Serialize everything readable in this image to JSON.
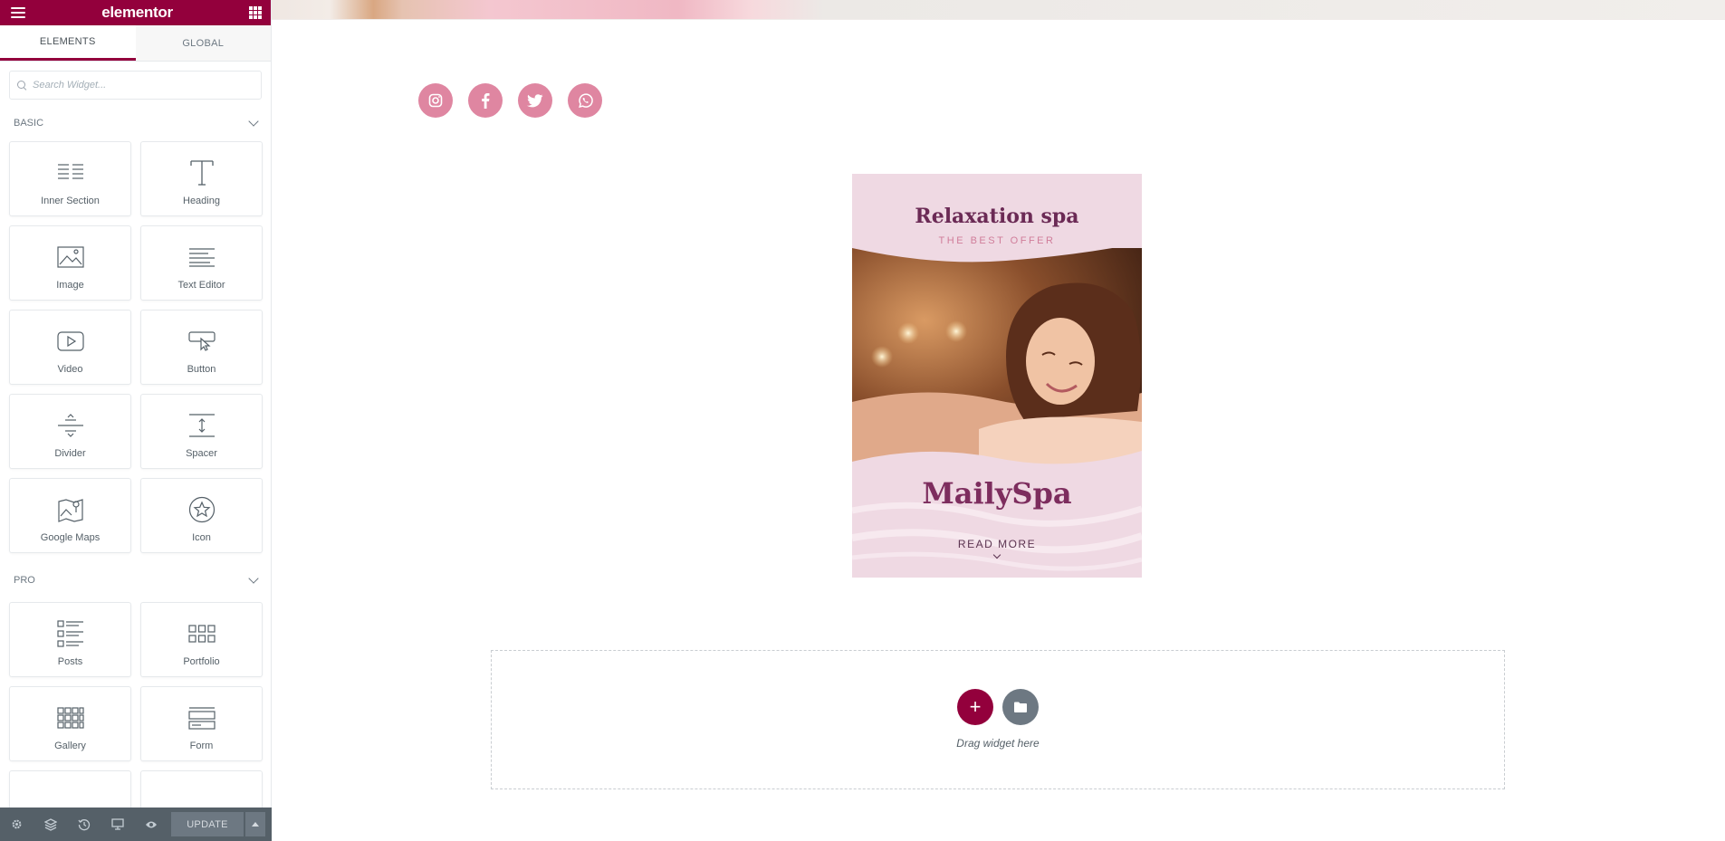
{
  "app": {
    "logo": "elementor"
  },
  "tabs": [
    {
      "label": "ELEMENTS"
    },
    {
      "label": "GLOBAL"
    }
  ],
  "search": {
    "placeholder": "Search Widget..."
  },
  "categories": {
    "basic": {
      "label": "BASIC",
      "widgets": [
        {
          "label": "Inner Section",
          "icon": "inner-section-icon"
        },
        {
          "label": "Heading",
          "icon": "heading-icon"
        },
        {
          "label": "Image",
          "icon": "image-icon"
        },
        {
          "label": "Text Editor",
          "icon": "text-editor-icon"
        },
        {
          "label": "Video",
          "icon": "video-icon"
        },
        {
          "label": "Button",
          "icon": "button-icon"
        },
        {
          "label": "Divider",
          "icon": "divider-icon"
        },
        {
          "label": "Spacer",
          "icon": "spacer-icon"
        },
        {
          "label": "Google Maps",
          "icon": "google-maps-icon"
        },
        {
          "label": "Icon",
          "icon": "star-icon"
        }
      ]
    },
    "pro": {
      "label": "PRO",
      "widgets": [
        {
          "label": "Posts",
          "icon": "posts-icon"
        },
        {
          "label": "Portfolio",
          "icon": "portfolio-icon"
        },
        {
          "label": "Gallery",
          "icon": "gallery-icon"
        },
        {
          "label": "Form",
          "icon": "form-icon"
        }
      ]
    }
  },
  "bottombar": {
    "update_label": "UPDATE"
  },
  "canvas": {
    "socials": [
      "instagram",
      "facebook",
      "twitter",
      "whatsapp"
    ],
    "card": {
      "title": "Relaxation spa",
      "subtitle": "THE BEST OFFER",
      "brand": "MailySpa",
      "read_more": "READ MORE"
    },
    "dropzone": {
      "text": "Drag widget here",
      "add_label": "+"
    }
  },
  "colors": {
    "brand": "#93003c",
    "social": "#df86a1",
    "card_bg": "#efd9e3"
  }
}
